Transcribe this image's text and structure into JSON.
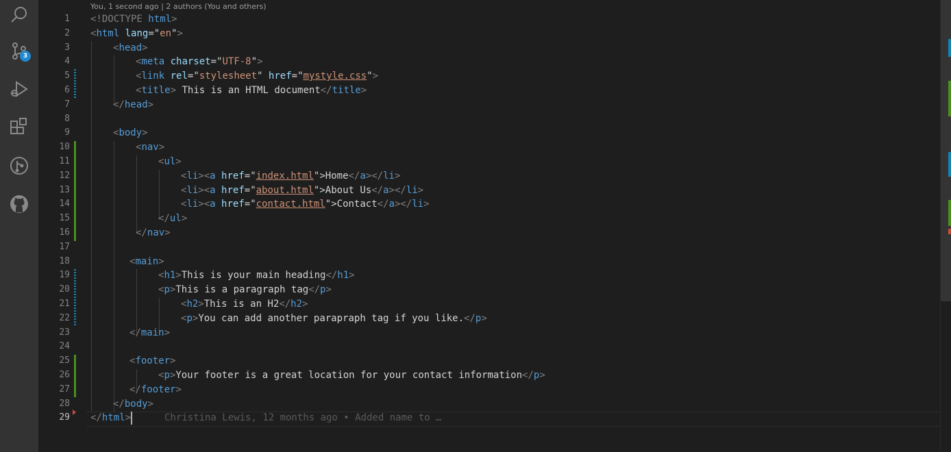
{
  "activity_bar": {
    "scm_badge": "3",
    "icons": [
      "search-icon",
      "source-control-icon",
      "run-debug-icon",
      "extensions-icon",
      "git-graph-icon",
      "github-icon"
    ]
  },
  "editor": {
    "codelens": "You, 1 second ago | 2 authors (You and others)",
    "blame": "Christina Lewis, 12 months ago • Added name to …",
    "line_numbers": [
      "1",
      "2",
      "3",
      "4",
      "5",
      "6",
      "7",
      "8",
      "9",
      "10",
      "11",
      "12",
      "13",
      "14",
      "15",
      "16",
      "17",
      "18",
      "19",
      "20",
      "21",
      "22",
      "23",
      "24",
      "25",
      "26",
      "27",
      "28",
      "29"
    ],
    "tokens": {
      "lt": "<",
      "gt": ">",
      "lt_slash": "</",
      "close_gt": "></",
      "eq_q": "=\"",
      "q_gt": "\">",
      "q": "\"",
      "doctype": "<!DOCTYPE",
      "html": "html",
      "lang": "lang",
      "en": "en",
      "head": "head",
      "meta": "meta",
      "charset": "charset",
      "utf8": "UTF-8",
      "link": "link",
      "rel": "rel",
      "stylesheet": "stylesheet",
      "href": "href",
      "mystyle": "mystyle.css",
      "title": "title",
      "title_text": " This is an HTML document",
      "body": "body",
      "nav": "nav",
      "ul": "ul",
      "li": "li",
      "a": "a",
      "index": "index.html",
      "home": "Home",
      "about": "about.html",
      "about_us": "About Us",
      "contact_href": "contact.html",
      "contact": "Contact",
      "main": "main",
      "h1": "h1",
      "h1_text": "This is your main heading",
      "p": "p",
      "p_text": "This is a paragraph tag",
      "h2": "h2",
      "h2_text": "This is an H2",
      "p2_text": "You can add another parapraph tag if you like.",
      "footer": "footer",
      "footer_text": "Your footer is a great location for your contact information"
    }
  },
  "colors": {
    "background": "#1e1e1e",
    "activity_bar": "#333333",
    "tag": "#569cd6",
    "attribute": "#9cdcfe",
    "string": "#ce9178",
    "punctuation": "#808080",
    "badge": "#1f8ad2",
    "added": "#4a8f1f",
    "modified": "#1b80b2",
    "deleted": "#c74e39"
  }
}
